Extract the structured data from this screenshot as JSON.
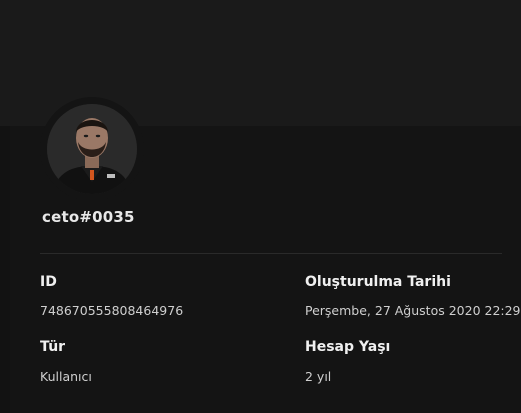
{
  "profile": {
    "username": "ceto#0035",
    "avatar_icon": "user-avatar-photo"
  },
  "details": {
    "id_label": "ID",
    "id_value": "748670555808464976",
    "created_label": "Oluşturulma Tarihi",
    "created_value": "Perşembe, 27 Ağustos 2020 22:29",
    "type_label": "Tür",
    "type_value": "Kullanıcı",
    "age_label": "Hesap Yaşı",
    "age_value": "2 yıl"
  }
}
